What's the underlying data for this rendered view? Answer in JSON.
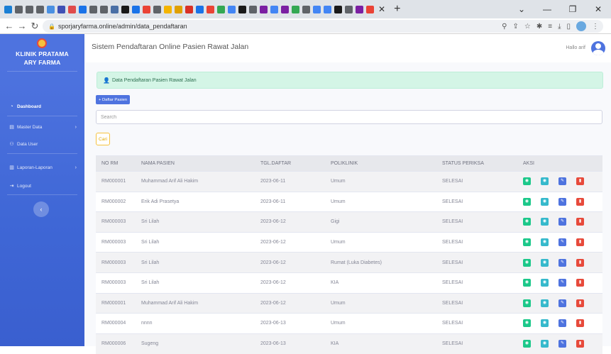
{
  "browser": {
    "url": "sporjaryfarma.online/admin/data_pendaftaran",
    "tab_icon_colors": [
      "#1a7fd4",
      "#5f6368",
      "#5f6368",
      "#5f6368",
      "#4a90e2",
      "#3f51b5",
      "#e04b4b",
      "#1a73e8",
      "#5f6368",
      "#5f6368",
      "#4a6fa5",
      "#1a1a1a",
      "#1a73e8",
      "#ea4335",
      "#5f6368",
      "#f4b400",
      "#e0a000",
      "#d93025",
      "#1a73e8",
      "#ea4335",
      "#34a853",
      "#4285f4",
      "#1a1a1a",
      "#5f6368",
      "#7b1fa2",
      "#4285f4",
      "#7b1fa2",
      "#34a853",
      "#5f6368",
      "#4285f4",
      "#4285f4",
      "#1a1a1a",
      "#5f6368",
      "#7b1fa2",
      "#ea4335"
    ],
    "new_tab": "+"
  },
  "sidebar": {
    "brand": "KLINIK PRATAMA ARY FARMA",
    "items": [
      {
        "label": "Dashboard",
        "icon": "tachometer-icon",
        "active": true
      },
      {
        "label": "Master Data",
        "icon": "folder-icon",
        "has_children": true
      },
      {
        "label": "Data User",
        "icon": "users-icon"
      },
      {
        "label": "Laporan-Laporan",
        "icon": "file-icon",
        "has_children": true
      },
      {
        "label": "Logout",
        "icon": "logout-icon"
      }
    ]
  },
  "topbar": {
    "title": "Sistem Pendaftaran Online Pasien Rawat Jalan",
    "user": "Hallo arif"
  },
  "main": {
    "alert": "Data Pendaftaran Pasien Rawat Jalan",
    "add_button": "+ Daftar Pasien",
    "search_placeholder": "Search",
    "search_button": "Cari",
    "table": {
      "headers": [
        "NO RM",
        "NAMA PASIEN",
        "TGL.DAFTAR",
        "POLIKLINIK",
        "STATUS PERIKSA",
        "AKSI"
      ],
      "rows": [
        [
          "RM000001",
          "Muhammad Arif Ali Hakim",
          "2023-06-11",
          "Umum",
          "SELESAI"
        ],
        [
          "RM000002",
          "Erik Adi Prasetya",
          "2023-06-11",
          "Umum",
          "SELESAI"
        ],
        [
          "RM000003",
          "Sri Lilah",
          "2023-06-12",
          "Gigi",
          "SELESAI"
        ],
        [
          "RM000003",
          "Sri Lilah",
          "2023-06-12",
          "Umum",
          "SELESAI"
        ],
        [
          "RM000003",
          "Sri Lilah",
          "2023-06-12",
          "Rumat (Luka Diabetes)",
          "SELESAI"
        ],
        [
          "RM000003",
          "Sri Lilah",
          "2023-06-12",
          "KIA",
          "SELESAI"
        ],
        [
          "RM000001",
          "Muhammad Arif Ali Hakim",
          "2023-06-12",
          "Umum",
          "SELESAI"
        ],
        [
          "RM000004",
          "nnnn",
          "2023-06-13",
          "Umum",
          "SELESAI"
        ],
        [
          "RM000006",
          "Sugeng",
          "2023-06-13",
          "KIA",
          "SELESAI"
        ]
      ]
    }
  }
}
